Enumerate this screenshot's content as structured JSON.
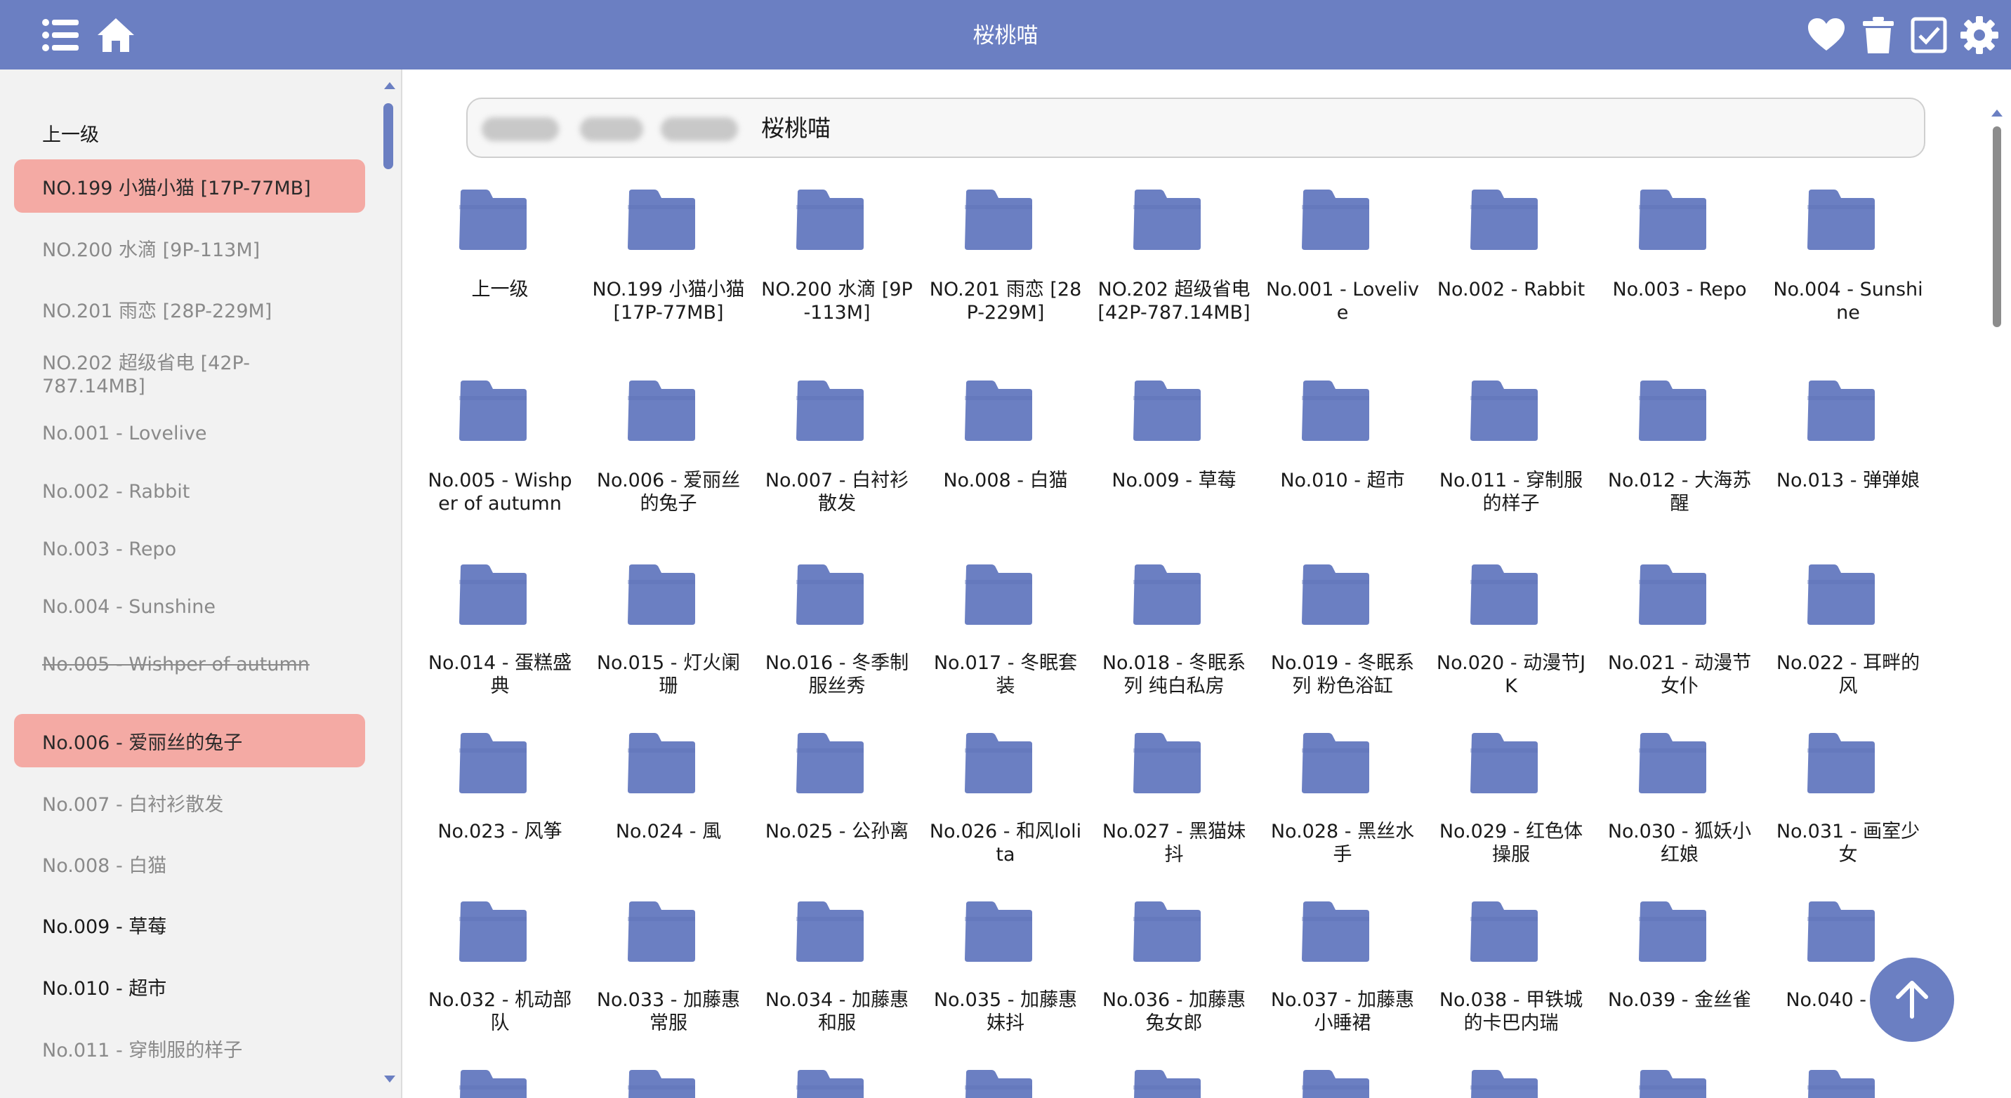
{
  "app": {
    "title": "桜桃喵",
    "accent_color": "#6b7fc2",
    "active_color": "#f4aaa4"
  },
  "toolbar": {
    "left_icons": [
      "list-icon",
      "home-icon"
    ],
    "right_icons": [
      "heart-icon",
      "trash-icon",
      "checkbox-icon",
      "gear-icon"
    ]
  },
  "sidebar": {
    "items": [
      {
        "label": "上一级",
        "style": "dark"
      },
      {
        "label": "NO.199 小猫小猫 [17P-77MB]",
        "style": "active"
      },
      {
        "label": "NO.200 水滴 [9P-113M]",
        "style": "muted"
      },
      {
        "label": "NO.201 雨恋 [28P-229M]",
        "style": "muted"
      },
      {
        "label": "NO.202 超级省电 [42P-787.14MB]",
        "style": "muted"
      },
      {
        "label": "No.001 - Lovelive",
        "style": "muted"
      },
      {
        "label": "No.002 - Rabbit",
        "style": "muted"
      },
      {
        "label": "No.003 - Repo",
        "style": "muted"
      },
      {
        "label": "No.004 - Sunshine",
        "style": "muted"
      },
      {
        "label": "No.005 - Wishper of autumn",
        "style": "strike"
      },
      {
        "label": "No.006 - 爱丽丝的兔子",
        "style": "active"
      },
      {
        "label": "No.007 - 白衬衫散发",
        "style": "muted"
      },
      {
        "label": "No.008 - 白猫",
        "style": "muted"
      },
      {
        "label": "No.009 - 草莓",
        "style": "dark"
      },
      {
        "label": "No.010 - 超市",
        "style": "dark"
      },
      {
        "label": "No.011 - 穿制服的样子",
        "style": "muted"
      }
    ]
  },
  "breadcrumb": {
    "current": "桜桃喵"
  },
  "folders": [
    "上一级",
    "NO.199 小猫小猫 [17P-77MB]",
    "NO.200 水滴 [9P-113M]",
    "NO.201 雨恋 [28P-229M]",
    "NO.202 超级省电 [42P-787.14MB]",
    "No.001 - Lovelive",
    "No.002 - Rabbit",
    "No.003 - Repo",
    "No.004 - Sunshine",
    "No.005 - Wishper of autumn",
    "No.006 - 爱丽丝的兔子",
    "No.007 - 白衬衫散发",
    "No.008 - 白猫",
    "No.009 - 草莓",
    "No.010 - 超市",
    "No.011 - 穿制服的样子",
    "No.012 - 大海苏醒",
    "No.013 - 弹弹娘",
    "No.014 - 蛋糕盛典",
    "No.015 - 灯火阑珊",
    "No.016 - 冬季制服丝秀",
    "No.017 - 冬眠套装",
    "No.018 - 冬眠系列 纯白私房",
    "No.019 - 冬眠系列 粉色浴缸",
    "No.020 - 动漫节JK",
    "No.021 - 动漫节女仆",
    "No.022 - 耳畔的风",
    "No.023 - 风筝",
    "No.024 - 風",
    "No.025 - 公孙离",
    "No.026 - 和风lolita",
    "No.027 - 黑猫妹抖",
    "No.028 - 黑丝水手",
    "No.029 - 红色体操服",
    "No.030 - 狐妖小红娘",
    "No.031 - 画室少女",
    "No.032 - 机动部队",
    "No.033 - 加藤惠常服",
    "No.034 - 加藤惠和服",
    "No.035 - 加藤惠妹抖",
    "No.036 - 加藤惠兔女郎",
    "No.037 - 加藤惠小睡裙",
    "No.038 - 甲铁城的卡巴内瑞",
    "No.039 - 金丝雀",
    "No.040 - 室女"
  ],
  "fab": {
    "icon": "arrow-up-icon"
  }
}
